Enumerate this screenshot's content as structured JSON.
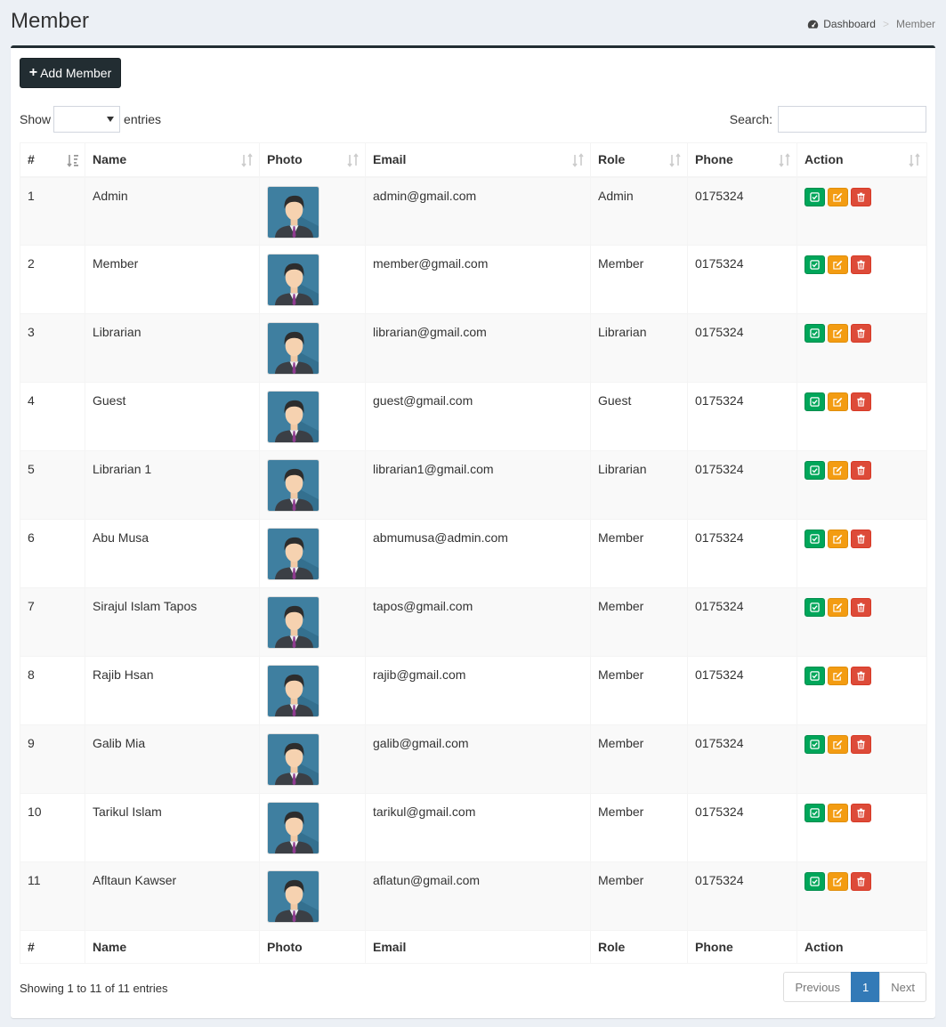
{
  "header": {
    "title": "Member",
    "breadcrumb": {
      "home": "Dashboard",
      "separator": ">",
      "current": "Member"
    }
  },
  "toolbar": {
    "add_label": "Add Member"
  },
  "length": {
    "prefix": "Show",
    "suffix": "entries",
    "value": ""
  },
  "search": {
    "label": "Search:",
    "value": "",
    "placeholder": ""
  },
  "table": {
    "columns": [
      "#",
      "Name",
      "Photo",
      "Email",
      "Role",
      "Phone",
      "Action"
    ],
    "rows": [
      {
        "num": "1",
        "name": "Admin",
        "email": "admin@gmail.com",
        "role": "Admin",
        "phone": "0175324"
      },
      {
        "num": "2",
        "name": "Member",
        "email": "member@gmail.com",
        "role": "Member",
        "phone": "0175324"
      },
      {
        "num": "3",
        "name": "Librarian",
        "email": "librarian@gmail.com",
        "role": "Librarian",
        "phone": "0175324"
      },
      {
        "num": "4",
        "name": "Guest",
        "email": "guest@gmail.com",
        "role": "Guest",
        "phone": "0175324"
      },
      {
        "num": "5",
        "name": "Librarian 1",
        "email": "librarian1@gmail.com",
        "role": "Librarian",
        "phone": "0175324"
      },
      {
        "num": "6",
        "name": "Abu Musa",
        "email": "abmumusa@admin.com",
        "role": "Member",
        "phone": "0175324"
      },
      {
        "num": "7",
        "name": "Sirajul Islam Tapos",
        "email": "tapos@gmail.com",
        "role": "Member",
        "phone": "0175324"
      },
      {
        "num": "8",
        "name": "Rajib Hsan",
        "email": "rajib@gmail.com",
        "role": "Member",
        "phone": "0175324"
      },
      {
        "num": "9",
        "name": "Galib Mia",
        "email": "galib@gmail.com",
        "role": "Member",
        "phone": "0175324"
      },
      {
        "num": "10",
        "name": "Tarikul Islam",
        "email": "tarikul@gmail.com",
        "role": "Member",
        "phone": "0175324"
      },
      {
        "num": "11",
        "name": "Afltaun Kawser",
        "email": "aflatun@gmail.com",
        "role": "Member",
        "phone": "0175324"
      }
    ]
  },
  "footer": {
    "info": "Showing 1 to 11 of 11 entries",
    "pagination": {
      "previous": "Previous",
      "page": "1",
      "next": "Next"
    }
  },
  "colors": {
    "accent": "#222d32",
    "success": "#00a65a",
    "warning": "#f39c12",
    "danger": "#dd4b39",
    "page_active": "#337ab7",
    "background": "#ecf0f5"
  },
  "icons": {
    "breadcrumb": "dashboard-icon",
    "add": "plus-icon",
    "sort": "sort-icon",
    "row_actions": [
      "check-square-icon",
      "edit-icon",
      "trash-icon"
    ]
  }
}
